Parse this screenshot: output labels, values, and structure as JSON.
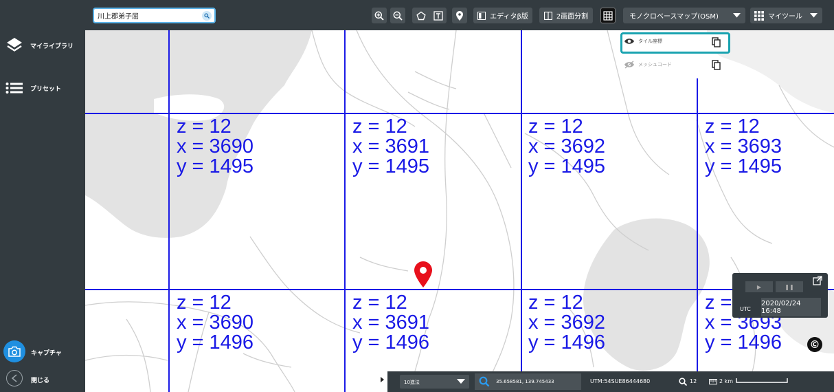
{
  "sidebar": {
    "items": [
      {
        "label": "マイライブラリ",
        "icon": "layers-icon"
      },
      {
        "label": "プリセット",
        "icon": "list-icon"
      }
    ],
    "capture_label": "キャプチャ",
    "close_label": "閉じる"
  },
  "toolbar": {
    "search_value": "川上郡弟子屈",
    "editor_label": "エディタβ版",
    "split_label": "2画面分割",
    "basemap_label": "モノクロベースマップ(OSM)",
    "mytools_label": "マイツール"
  },
  "tile_panel": {
    "items": [
      {
        "label": "タイル座標",
        "visible": true
      },
      {
        "label": "メッシュコード",
        "visible": false
      }
    ]
  },
  "tiles": [
    {
      "z": "z = 12",
      "x": "x = 3690",
      "y": "y = 1495"
    },
    {
      "z": "z = 12",
      "x": "x = 3691",
      "y": "y = 1495"
    },
    {
      "z": "z = 12",
      "x": "x = 3692",
      "y": "y = 1495"
    },
    {
      "z": "z = 12",
      "x": "x = 3693",
      "y": "y = 1495"
    },
    {
      "z": "z = 12",
      "x": "x = 3690",
      "y": "y = 1496"
    },
    {
      "z": "z = 12",
      "x": "x = 3691",
      "y": "y = 1496"
    },
    {
      "z": "z = 12",
      "x": "x = 3692",
      "y": "y = 1496"
    },
    {
      "z": "z = 12",
      "x": "x = 3693",
      "y": "y = 1496"
    }
  ],
  "time_panel": {
    "tz": "UTC",
    "datetime": "2020/02/24 16:48"
  },
  "statusbar": {
    "coord_format": "10進法",
    "latlng": "35.658581, 139.745433",
    "utm": "UTM:54SUE86444680",
    "zoom": "12",
    "scale": "2 km"
  },
  "colors": {
    "panel_bg": "#333b40",
    "grid_line": "#1a1ae6",
    "pin": "#e8101c",
    "accent": "#1f8fe0",
    "panel_border": "#1aa3b0"
  }
}
